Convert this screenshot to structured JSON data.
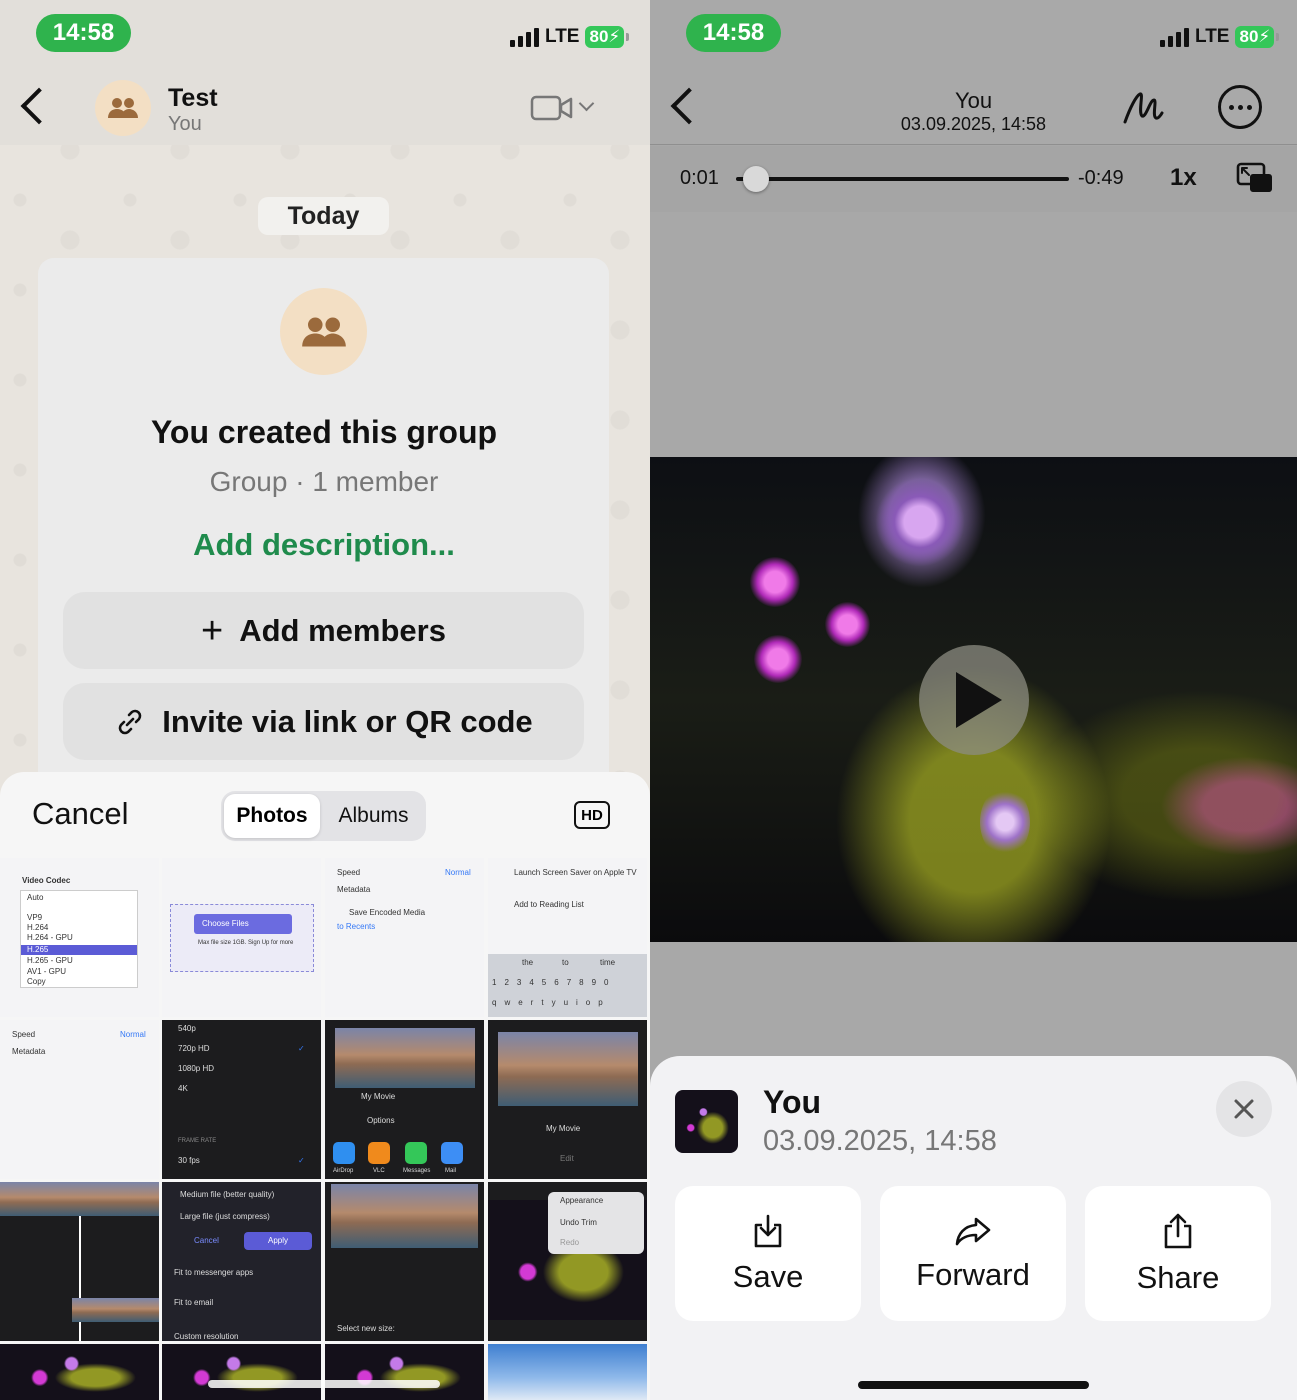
{
  "status_bar": {
    "time": "14:58",
    "network": "LTE",
    "battery": "80"
  },
  "chat": {
    "title": "Test",
    "subtitle": "You",
    "icons": {
      "back": "back-chevron-icon",
      "video": "video-camera-icon",
      "dropdown": "chevron-down-icon",
      "group_avatar": "group-people-icon"
    },
    "date_pill": "Today",
    "group_card": {
      "title": "You created this group",
      "subtitle": "Group · 1 member",
      "add_description": "Add description...",
      "add_members_label": "Add members",
      "invite_label": "Invite via link or QR code"
    }
  },
  "picker": {
    "cancel_label": "Cancel",
    "tabs": [
      {
        "label": "Photos",
        "active": true
      },
      {
        "label": "Albums",
        "active": false
      }
    ],
    "hd_label": "HD",
    "thumbnails": {
      "t1": {
        "codec_title": "Video Codec",
        "codecs": [
          "Auto",
          "VP9",
          "H.264",
          "H.264 - GPU",
          "H.265",
          "H.265 - GPU",
          "AV1 - GPU",
          "Copy"
        ]
      },
      "t2": {
        "choose_files": "Choose Files",
        "max_size": "Max file size 1GB. Sign Up for more"
      },
      "t3": {
        "speed": "Speed",
        "speed_value": "Normal",
        "metadata": "Metadata",
        "save_line": "Save Encoded Media",
        "to_line": "to Recents"
      },
      "t4": {
        "launch": "Launch Screen Saver on Apple TV",
        "reading": "Add to Reading List",
        "kb_suggest": [
          "the",
          "to",
          "time"
        ],
        "kb_row1": "1234567890",
        "kb_row2": "qwertyuiop"
      },
      "t5": {
        "speed": "Speed",
        "speed_value": "Normal",
        "metadata": "Metadata"
      },
      "t6": {
        "resolutions": [
          "540p",
          "720p HD",
          "1080p HD",
          "4K"
        ],
        "frame_rate": "FRAME RATE",
        "fps": "30 fps"
      },
      "t7": {
        "movie": "My Movie",
        "options": "Options",
        "apps": [
          "AirDrop",
          "VLC",
          "Messages",
          "Mail"
        ]
      },
      "t8": {
        "movie": "My Movie",
        "edit": "Edit"
      },
      "t10": {
        "medium": "Medium file (better quality)",
        "large": "Large file (just compress)",
        "cancel": "Cancel",
        "apply": "Apply",
        "fit_messenger": "Fit to messenger apps",
        "fit_email": "Fit to email",
        "custom": "Custom resolution"
      },
      "t11": {
        "select_size": "Select new size:"
      },
      "t12": {
        "appearance": "Appearance",
        "undo": "Undo Trim",
        "redo": "Redo"
      }
    }
  },
  "viewer": {
    "title": "You",
    "date": "03.09.2025, 14:58",
    "current_time": "0:01",
    "remaining_time": "-0:49",
    "speed": "1x",
    "progress": 0.02,
    "icons": {
      "back": "back-chevron-icon",
      "markup": "markup-pen-icon",
      "more": "more-ellipsis-icon",
      "pip": "picture-in-picture-icon",
      "play": "play-icon"
    }
  },
  "info_sheet": {
    "name": "You",
    "date": "03.09.2025, 14:58",
    "actions": [
      {
        "label": "Save",
        "icon": "save-download-icon"
      },
      {
        "label": "Forward",
        "icon": "forward-arrow-icon"
      },
      {
        "label": "Share",
        "icon": "share-icon"
      }
    ]
  },
  "colors": {
    "status_green": "#2fb34d",
    "accent_green": "#1f8b4c",
    "battery_green": "#34c759"
  }
}
